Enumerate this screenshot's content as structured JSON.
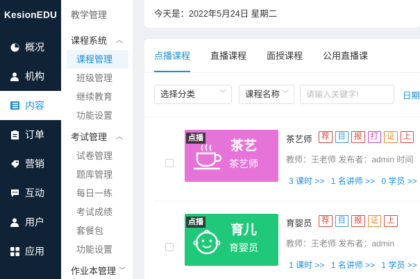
{
  "brand": "KesionEDU",
  "sidebar": {
    "items": [
      {
        "label": "概况",
        "icon": "dashboard-icon"
      },
      {
        "label": "机构",
        "icon": "user-icon"
      },
      {
        "label": "内容",
        "icon": "content-icon",
        "active": true
      },
      {
        "label": "订单",
        "icon": "order-icon"
      },
      {
        "label": "营销",
        "icon": "marketing-icon"
      },
      {
        "label": "互动",
        "icon": "chat-icon"
      },
      {
        "label": "用户",
        "icon": "person-icon"
      },
      {
        "label": "应用",
        "icon": "apps-icon"
      }
    ]
  },
  "submenu": {
    "top": "教学管理",
    "group1": "课程系统",
    "group1_items": [
      "课程管理",
      "班级管理",
      "继续教育",
      "功能设置"
    ],
    "group2": "考试管理",
    "group2_items": [
      "试卷管理",
      "题库管理",
      "每日一练",
      "考试成绩",
      "套餐包",
      "功能设置"
    ],
    "group3": "作业本管理"
  },
  "datebar": "今天是：2022年5月24日 星期二",
  "tabs": [
    "点播课程",
    "直播课程",
    "面授课程",
    "公用直播课"
  ],
  "filters": {
    "category": "选择分类",
    "field": "课程名称",
    "search_placeholder": "请输入关键字!",
    "date_label": "日期"
  },
  "courses": [
    {
      "badge": "点播",
      "thumb_title": "茶艺",
      "thumb_sub": "茶艺师",
      "thumb_color": "#e674d8",
      "title": "茶艺师",
      "tags": [
        "荐",
        "目",
        "报",
        "打",
        "证",
        "上"
      ],
      "meta": "教师：王老师 发布者：admin   时间",
      "lessons": "3 课时 >>",
      "teachers": "1 名讲师 >>",
      "students": "0 学员 >>"
    },
    {
      "badge": "点播",
      "thumb_title": "育儿",
      "thumb_sub": "育婴员",
      "thumb_color": "#20c97a",
      "title": "育婴员",
      "tags": [
        "荐",
        "目",
        "报",
        "证",
        "上"
      ],
      "meta": "教师：王老师 发布者：admin",
      "lessons": "1 课时 >>",
      "teachers": "1 名讲师 >>",
      "students": "1 学员 >>"
    }
  ],
  "colors": {
    "accent": "#1a8fd8",
    "sidebar_bg": "#0f2236"
  }
}
